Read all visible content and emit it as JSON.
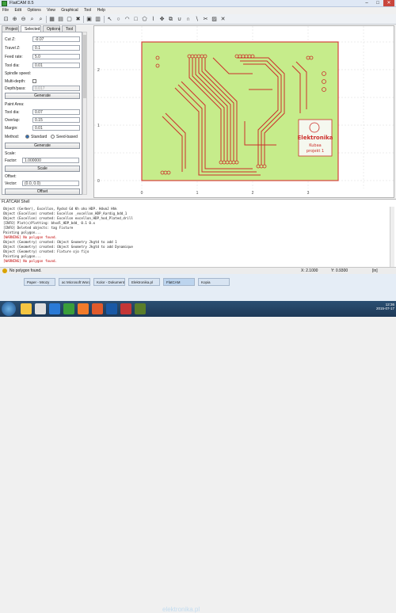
{
  "window": {
    "title": "FlatCAM 8.5",
    "minimize": "–",
    "maximize": "□",
    "close": "✕"
  },
  "menu": [
    "File",
    "Edit",
    "Options",
    "View",
    "Graphical",
    "Tool",
    "Help"
  ],
  "left_tabs": [
    "Project",
    "Selected",
    "Options",
    "Tool"
  ],
  "panel": {
    "rows": [
      {
        "label": "Cut Z:",
        "value": "-0.07"
      },
      {
        "label": "Travel Z:",
        "value": "0.1"
      },
      {
        "label": "Feed rate:",
        "value": "5.0"
      },
      {
        "label": "Tool dia:",
        "value": "0.01"
      }
    ],
    "spindle_label": "Spindle speed:",
    "multidepth_label": "Multi-depth:",
    "depth_pass_label": "Depth/pass:",
    "depth_pass_value": "0.017",
    "generate_button": "Generate",
    "paint_area": {
      "title": "Paint Area:",
      "rows": [
        {
          "label": "Tool dia:",
          "value": "0.07"
        },
        {
          "label": "Overlap:",
          "value": "0.15"
        },
        {
          "label": "Margin:",
          "value": "0.01"
        }
      ],
      "method_label": "Method:",
      "method_options": [
        "Standard",
        "Seed-based"
      ],
      "generate_button": "Generate"
    },
    "scale": {
      "title": "Scale:",
      "factor_label": "Factor:",
      "factor_value": "1.000000",
      "button": "Scale"
    },
    "offset": {
      "title": "Offset:",
      "vector_label": "Vector:",
      "vector_value": "(0.0, 0.0)",
      "button": "Offset"
    }
  },
  "canvas": {
    "x_ticks": [
      "0",
      "1",
      "2",
      "3"
    ],
    "y_ticks": [
      "2",
      "1",
      "0"
    ],
    "board_text": [
      "Elektronika",
      "Kubaa",
      "projekt 1"
    ]
  },
  "log": {
    "title": "FLATCAM Shell",
    "lines": [
      {
        "text": "Object (Gerber), Excellon, Rydsd Gd Kh oho HDP. HdvmJ Hhk",
        "type": "normal"
      },
      {
        "text": "Object (Excellon) created: Excellon _excellon_HDP_Aardig_bdd_1",
        "type": "normal"
      },
      {
        "text": "Object (Excellon) created: Excellon excellon_HDP_hod_Plated_drill",
        "type": "normal"
      },
      {
        "text": "[INFO] Plot(s)Plotting: bhxdl_HDP_bdd_ 0.1 0.x",
        "type": "normal"
      },
      {
        "text": "[INFO] Deleted objects: tag Fixture",
        "type": "normal"
      },
      {
        "text": "Painting polygon...",
        "type": "normal"
      },
      {
        "text": "[WARNING] No polygon found.",
        "type": "error"
      },
      {
        "text": "Object (Geometry) created: Object Geometry Jkgtd to add 1",
        "type": "normal"
      },
      {
        "text": "Object (Geometry) created: Object Geometry Jkgtd to add Dynamique",
        "type": "normal"
      },
      {
        "text": "Object (Geometry) created: Fixture ojo fijo",
        "type": "normal"
      },
      {
        "text": "Painting polygon...",
        "type": "normal"
      },
      {
        "text": "[WARNING] No polygon found.",
        "type": "error"
      }
    ]
  },
  "status": {
    "message": "No polygon found.",
    "x": "X: 2.1000",
    "y": "Y: 0.9300",
    "units": "[in]"
  },
  "taskbar": {
    "windows": [
      "Paper - Mrozy",
      "ac Microsoft Word",
      "Kolor - Dokument",
      "Elektronika.pl",
      "FlatCAM",
      "Kopia"
    ],
    "time": "12:36",
    "date": "2015-07-17",
    "watermark": "elektronika.pl"
  },
  "colors": {
    "board_fill": "#c6ec8b",
    "board_outline": "#d7413c",
    "trace": "#cc2f2b",
    "accent": "#1f6aa5"
  }
}
